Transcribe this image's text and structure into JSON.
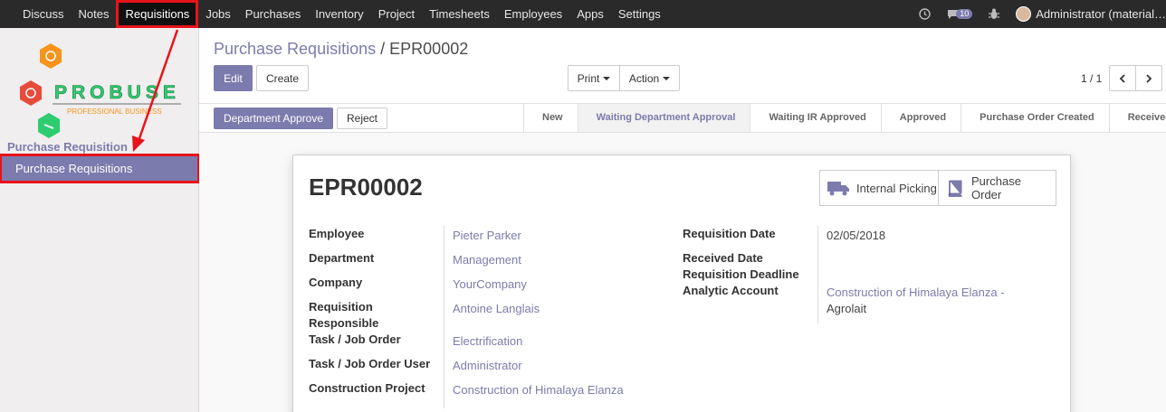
{
  "nav": {
    "menu": [
      "Discuss",
      "Notes",
      "Requisitions",
      "Jobs",
      "Purchases",
      "Inventory",
      "Project",
      "Timesheets",
      "Employees",
      "Apps",
      "Settings"
    ],
    "active_index": 2,
    "chat_count": "10",
    "user": "Administrator (material…"
  },
  "sidebar": {
    "logo_text": "PROBUSE",
    "logo_subtitle": "PROFESSIONAL BUSINESS",
    "category": "Purchase Requisition",
    "item": "Purchase Requisitions"
  },
  "control": {
    "breadcrumb_parent": "Purchase Requisitions",
    "breadcrumb_sep": "/",
    "breadcrumb_current": "EPR00002",
    "edit": "Edit",
    "create": "Create",
    "print": "Print",
    "action": "Action",
    "pager": "1 / 1"
  },
  "statusbar": {
    "approve": "Department Approve",
    "reject": "Reject",
    "stages": [
      "New",
      "Waiting Department Approval",
      "Waiting IR Approved",
      "Approved",
      "Purchase Order Created",
      "Received"
    ],
    "current_index": 1
  },
  "form": {
    "title": "EPR00002",
    "smart_buttons": {
      "picking": "Internal Picking",
      "po_line1": "Purchase",
      "po_line2": "Order"
    },
    "left_fields": [
      {
        "label": "Employee",
        "value": "Pieter Parker"
      },
      {
        "label": "Department",
        "value": "Management"
      },
      {
        "label": "Company",
        "value": "YourCompany"
      },
      {
        "label": "Requisition Responsible",
        "value": "Antoine Langlais"
      },
      {
        "label": "Task / Job Order",
        "value": "Electrification"
      },
      {
        "label": "Task / Job Order User",
        "value": "Administrator"
      },
      {
        "label": "Construction Project",
        "value": "Construction of Himalaya Elanza"
      }
    ],
    "right_fields": {
      "req_date_label": "Requisition Date",
      "req_date": "02/05/2018",
      "received_label": "Received Date",
      "deadline_label": "Requisition Deadline",
      "analytic_label": "Analytic Account",
      "analytic_value_line1": "Construction of Himalaya Elanza -",
      "analytic_value_line2": "Agrolait"
    }
  },
  "colors": {
    "accent": "#7c7bad",
    "annotation": "#e8131a",
    "topbar": "#2a2a2a"
  }
}
